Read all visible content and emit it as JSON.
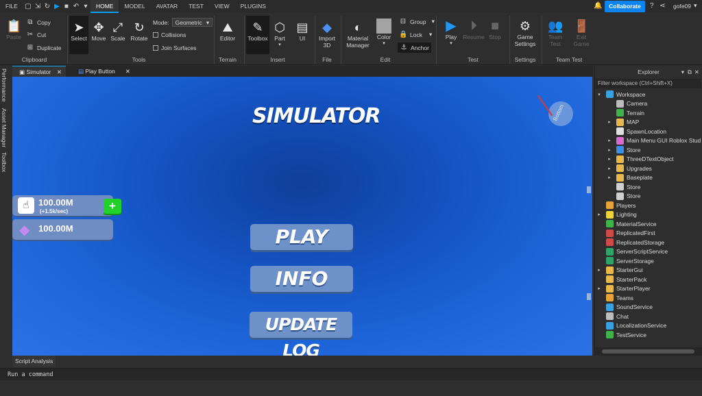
{
  "menubar": {
    "file": "FILE",
    "tabs": [
      "HOME",
      "MODEL",
      "AVATAR",
      "TEST",
      "VIEW",
      "PLUGINS"
    ],
    "active_tab": "HOME",
    "collaborate": "Collaborate",
    "username": "gofe09"
  },
  "ribbon": {
    "clipboard": {
      "paste": "Paste",
      "copy": "Copy",
      "cut": "Cut",
      "duplicate": "Duplicate",
      "label": "Clipboard"
    },
    "tools": {
      "select": "Select",
      "move": "Move",
      "scale": "Scale",
      "rotate": "Rotate",
      "mode_label": "Mode:",
      "mode_value": "Geometric",
      "collisions": "Collisions",
      "join_surfaces": "Join Surfaces",
      "label": "Tools"
    },
    "terrain": {
      "editor": "Editor",
      "label": "Terrain"
    },
    "insert": {
      "toolbox": "Toolbox",
      "part": "Part",
      "ui": "UI",
      "label": "Insert"
    },
    "file": {
      "import3d": "Import\n3D",
      "import_line1": "Import",
      "import_line2": "3D",
      "label": "File"
    },
    "edit": {
      "material_line1": "Material",
      "material_line2": "Manager",
      "color": "Color",
      "group": "Group",
      "lock": "Lock",
      "anchor": "Anchor",
      "label": "Edit"
    },
    "test": {
      "play": "Play",
      "resume": "Resume",
      "stop": "Stop",
      "label": "Test"
    },
    "settings": {
      "game_line1": "Game",
      "game_line2": "Settings",
      "label": "Settings"
    },
    "team_test": {
      "team_line1": "Team",
      "team_line2": "Test",
      "exit_line1": "Exit",
      "exit_line2": "Game",
      "label": "Team Test"
    }
  },
  "left_rail": [
    "Performance",
    "Asset Manager",
    "Toolbox"
  ],
  "doc_tabs": [
    "Simulator",
    "Play Button"
  ],
  "viewport": {
    "title": "SIMULATOR",
    "cube_face": "Bottom",
    "stat_clicks": "100.00M",
    "stat_rate": "(+1.5k/sec)",
    "stat_gems": "100.00M",
    "btn_play": "PLAY",
    "btn_info": "INFO",
    "btn_update": "UPDATE LOG"
  },
  "explorer": {
    "title": "Explorer",
    "filter_placeholder": "Filter workspace (Ctrl+Shift+X)",
    "items": [
      {
        "name": "Workspace",
        "indent": 0,
        "arrow": "▾",
        "color": "#3aa0e0"
      },
      {
        "name": "Camera",
        "indent": 1,
        "arrow": "",
        "color": "#bdbdbd"
      },
      {
        "name": "Terrain",
        "indent": 1,
        "arrow": "",
        "color": "#3db34a"
      },
      {
        "name": "MAP",
        "indent": 1,
        "arrow": "▸",
        "color": "#e8b94a"
      },
      {
        "name": "SpawnLocation",
        "indent": 1,
        "arrow": "",
        "color": "#e0e0e0"
      },
      {
        "name": "Main Menu GUI Roblox Stud",
        "indent": 1,
        "arrow": "▸",
        "color": "#d96ad4"
      },
      {
        "name": "Store",
        "indent": 1,
        "arrow": "▸",
        "color": "#3a8ee8"
      },
      {
        "name": "ThreeDTextObject",
        "indent": 1,
        "arrow": "▸",
        "color": "#e8b94a"
      },
      {
        "name": "Upgrades",
        "indent": 1,
        "arrow": "▸",
        "color": "#e8b94a"
      },
      {
        "name": "Baseplate",
        "indent": 1,
        "arrow": "▸",
        "color": "#e8b94a"
      },
      {
        "name": "Store",
        "indent": 1,
        "arrow": "",
        "color": "#cfcfcf"
      },
      {
        "name": "Store",
        "indent": 1,
        "arrow": "",
        "color": "#cfcfcf"
      },
      {
        "name": "Players",
        "indent": 0,
        "arrow": "",
        "color": "#e8a23a"
      },
      {
        "name": "Lighting",
        "indent": 0,
        "arrow": "▸",
        "color": "#f0d23a"
      },
      {
        "name": "MaterialService",
        "indent": 0,
        "arrow": "",
        "color": "#3db34a"
      },
      {
        "name": "ReplicatedFirst",
        "indent": 0,
        "arrow": "",
        "color": "#d04a4a"
      },
      {
        "name": "ReplicatedStorage",
        "indent": 0,
        "arrow": "",
        "color": "#d04a4a"
      },
      {
        "name": "ServerScriptService",
        "indent": 0,
        "arrow": "",
        "color": "#2fa36a"
      },
      {
        "name": "ServerStorage",
        "indent": 0,
        "arrow": "",
        "color": "#2fa36a"
      },
      {
        "name": "StarterGui",
        "indent": 0,
        "arrow": "▸",
        "color": "#e8b94a"
      },
      {
        "name": "StarterPack",
        "indent": 0,
        "arrow": "",
        "color": "#e8b94a"
      },
      {
        "name": "StarterPlayer",
        "indent": 0,
        "arrow": "▸",
        "color": "#e8b94a"
      },
      {
        "name": "Teams",
        "indent": 0,
        "arrow": "",
        "color": "#e8a23a"
      },
      {
        "name": "SoundService",
        "indent": 0,
        "arrow": "",
        "color": "#3aa0e0"
      },
      {
        "name": "Chat",
        "indent": 0,
        "arrow": "",
        "color": "#bdbdbd"
      },
      {
        "name": "LocalizationService",
        "indent": 0,
        "arrow": "",
        "color": "#3aa0e0"
      },
      {
        "name": "TestService",
        "indent": 0,
        "arrow": "",
        "color": "#3db34a"
      }
    ]
  },
  "bottom": {
    "script_analysis": "Script Analysis",
    "command_placeholder": "Run a command"
  }
}
